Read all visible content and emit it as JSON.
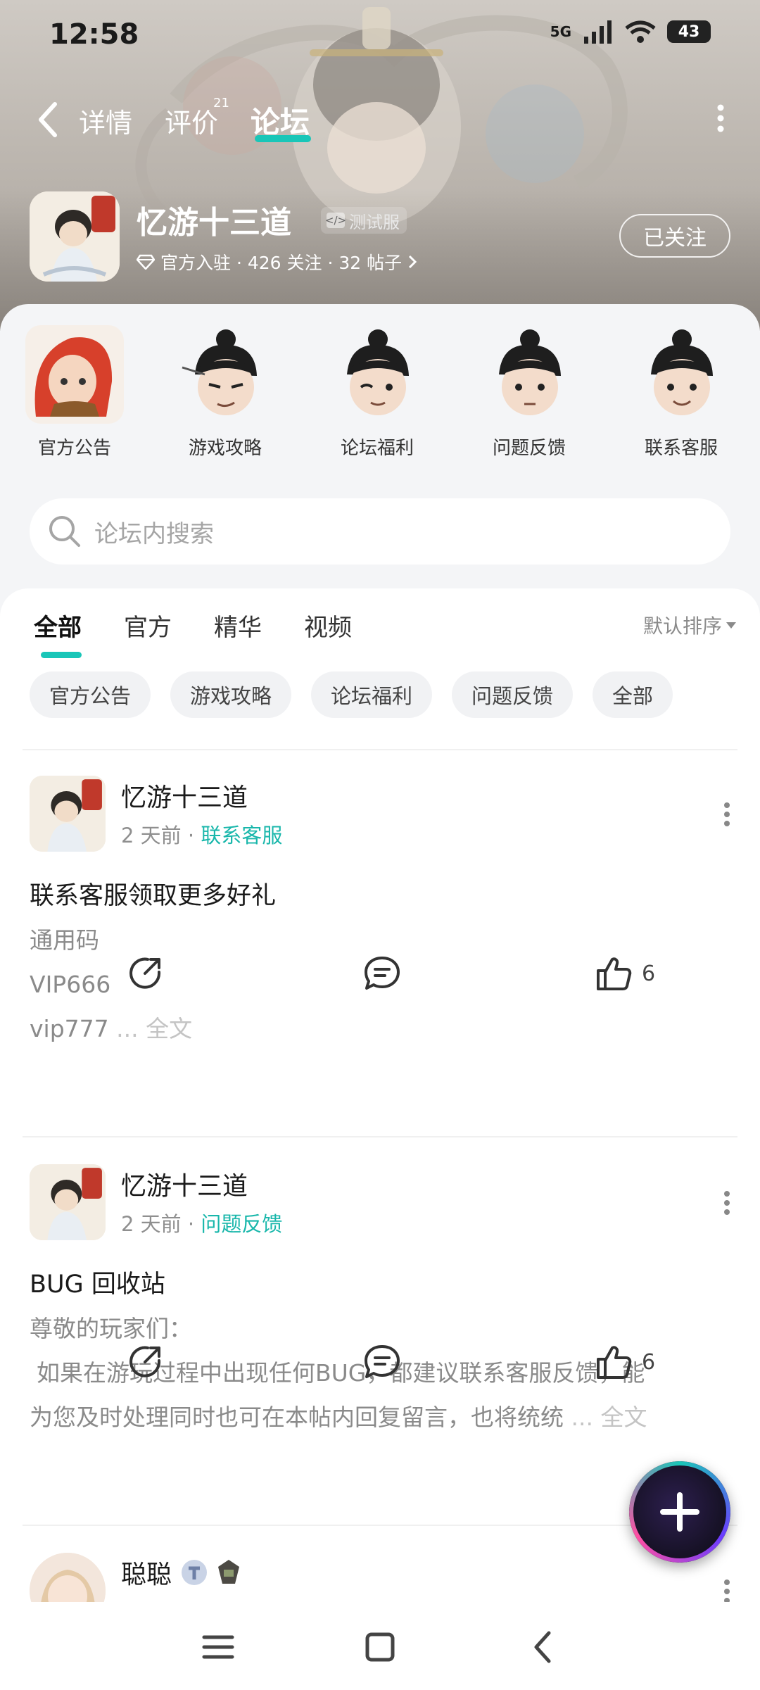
{
  "status_bar": {
    "time": "12:58",
    "network": "5G",
    "battery": "43"
  },
  "nav": {
    "tabs": [
      {
        "label": "详情"
      },
      {
        "label": "评价",
        "badge": "21"
      },
      {
        "label": "论坛",
        "active": true
      }
    ]
  },
  "game": {
    "title": "忆游十三道",
    "badge": "测试服",
    "meta": "官方入驻 · 426 关注 · 32 帖子",
    "follow_label": "已关注"
  },
  "categories": [
    {
      "label": "官方公告",
      "icon": "red-hair-character-avatar"
    },
    {
      "label": "游戏攻略",
      "icon": "swordsman-avatar-smirk"
    },
    {
      "label": "论坛福利",
      "icon": "swordsman-avatar-wink"
    },
    {
      "label": "问题反馈",
      "icon": "swordsman-avatar-neutral"
    },
    {
      "label": "联系客服",
      "icon": "swordsman-avatar-smile"
    }
  ],
  "search": {
    "placeholder": "论坛内搜索"
  },
  "filter_tabs": [
    {
      "label": "全部",
      "active": true
    },
    {
      "label": "官方"
    },
    {
      "label": "精华"
    },
    {
      "label": "视频"
    }
  ],
  "sort_label": "默认排序",
  "chips": [
    "官方公告",
    "游戏攻略",
    "论坛福利",
    "问题反馈",
    "全部"
  ],
  "posts": [
    {
      "author": "忆游十三道",
      "time": "2 天前",
      "category": "联系客服",
      "title": "联系客服领取更多好礼",
      "lines": [
        "通用码",
        "VIP666",
        "vip777"
      ],
      "more": " ... 全文",
      "likes": "6"
    },
    {
      "author": "忆游十三道",
      "time": "2 天前",
      "category": "问题反馈",
      "title": "BUG 回收站",
      "lines": [
        "尊敬的玩家们：",
        "如果在游玩过程中出现任何BUG，都建议联系客服反馈，能",
        "为您及时处理同时也可在本帖内回复留言，也将统统"
      ],
      "more": " ... 全文",
      "likes": "6"
    },
    {
      "author": "聪聪"
    }
  ],
  "colors": {
    "accent": "#19c6b8",
    "category_text": "#19b7ab"
  }
}
